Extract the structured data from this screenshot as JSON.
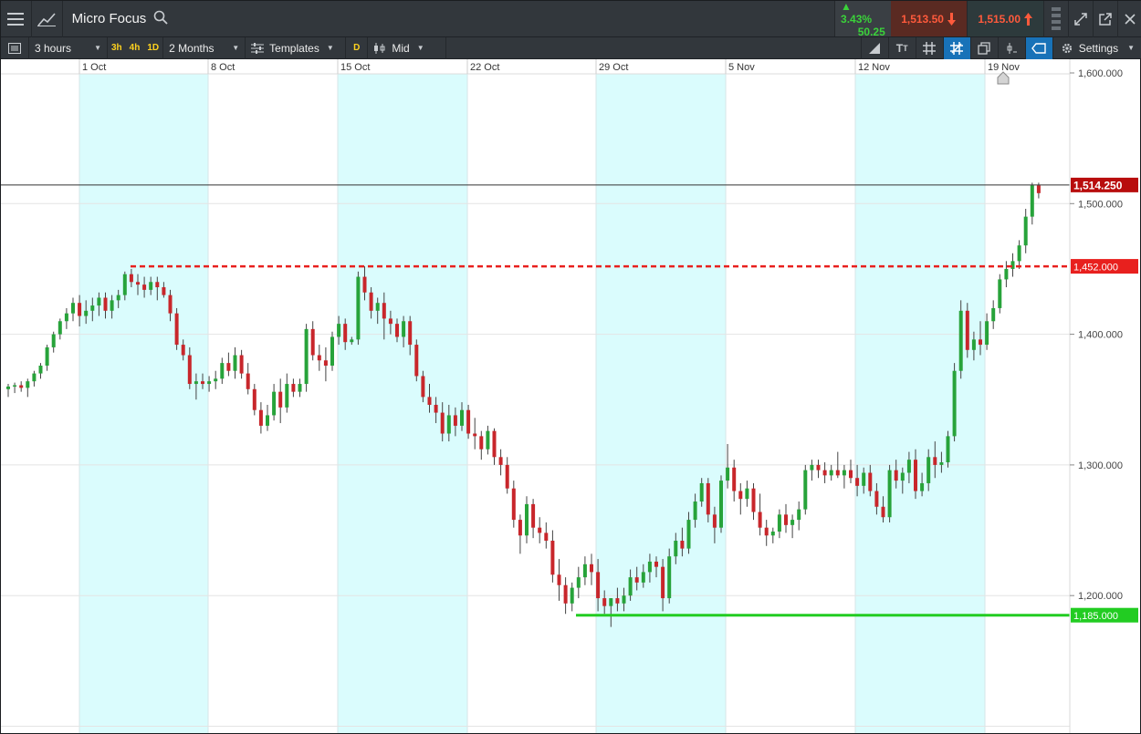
{
  "window": {
    "title": "Micro Focus",
    "change_pct": "3.43%",
    "change_abs": "50.25",
    "sell_price": "1,513.50",
    "buy_price": "1,515.00"
  },
  "toolbar": {
    "interval": "3 hours",
    "quick_intervals": [
      "3h",
      "4h",
      "1D"
    ],
    "range": "2 Months",
    "templates": "Templates",
    "d_label": "D",
    "price_type": "Mid",
    "settings": "Settings"
  },
  "colors": {
    "up": "#27a33a",
    "down": "#c8262b",
    "resistance": "#e8201e",
    "support": "#22cc22",
    "weekend_band": "#dafcfd",
    "current_price": "#b80d0d"
  },
  "icons": {
    "menu": "hamburger-icon",
    "chart": "line-chart-icon",
    "search": "search-icon",
    "settings": "gear-icon"
  },
  "chart_data": {
    "type": "candlestick",
    "x_labels": [
      "1 Oct",
      "8 Oct",
      "15 Oct",
      "22 Oct",
      "29 Oct",
      "5 Nov",
      "12 Nov",
      "19 Nov"
    ],
    "y_labels": [
      "1,600.000",
      "1,500.000",
      "1,400.000",
      "1,300.000",
      "1,200.000"
    ],
    "y_range": [
      1082,
      1610
    ],
    "current_price": {
      "value": 1514.25,
      "label": "1,514.250"
    },
    "resistance": {
      "value": 1452,
      "label": "1,452.000"
    },
    "support": {
      "value": 1185,
      "label": "1,185.000"
    },
    "candles": [
      [
        1358,
        1362,
        1352,
        1360
      ],
      [
        1360,
        1363,
        1355,
        1361
      ],
      [
        1361,
        1364,
        1356,
        1359
      ],
      [
        1359,
        1366,
        1352,
        1364
      ],
      [
        1364,
        1372,
        1360,
        1370
      ],
      [
        1370,
        1378,
        1366,
        1376
      ],
      [
        1376,
        1392,
        1372,
        1390
      ],
      [
        1390,
        1402,
        1386,
        1400
      ],
      [
        1400,
        1412,
        1396,
        1410
      ],
      [
        1410,
        1420,
        1404,
        1416
      ],
      [
        1416,
        1428,
        1410,
        1424
      ],
      [
        1424,
        1430,
        1406,
        1414
      ],
      [
        1414,
        1426,
        1408,
        1418
      ],
      [
        1418,
        1428,
        1410,
        1422
      ],
      [
        1422,
        1432,
        1414,
        1428
      ],
      [
        1428,
        1432,
        1412,
        1418
      ],
      [
        1418,
        1430,
        1412,
        1426
      ],
      [
        1426,
        1434,
        1420,
        1430
      ],
      [
        1430,
        1448,
        1426,
        1446
      ],
      [
        1446,
        1450,
        1436,
        1440
      ],
      [
        1440,
        1446,
        1430,
        1438
      ],
      [
        1438,
        1444,
        1428,
        1434
      ],
      [
        1434,
        1444,
        1430,
        1440
      ],
      [
        1440,
        1444,
        1426,
        1436
      ],
      [
        1436,
        1440,
        1428,
        1430
      ],
      [
        1430,
        1434,
        1410,
        1416
      ],
      [
        1416,
        1420,
        1388,
        1392
      ],
      [
        1392,
        1396,
        1380,
        1384
      ],
      [
        1384,
        1390,
        1358,
        1362
      ],
      [
        1362,
        1370,
        1350,
        1364
      ],
      [
        1364,
        1370,
        1358,
        1362
      ],
      [
        1362,
        1368,
        1356,
        1364
      ],
      [
        1364,
        1372,
        1358,
        1366
      ],
      [
        1366,
        1382,
        1362,
        1378
      ],
      [
        1378,
        1386,
        1368,
        1372
      ],
      [
        1372,
        1390,
        1366,
        1384
      ],
      [
        1384,
        1388,
        1366,
        1370
      ],
      [
        1370,
        1378,
        1354,
        1358
      ],
      [
        1358,
        1362,
        1338,
        1342
      ],
      [
        1342,
        1348,
        1324,
        1330
      ],
      [
        1330,
        1346,
        1326,
        1338
      ],
      [
        1338,
        1362,
        1334,
        1356
      ],
      [
        1356,
        1366,
        1332,
        1344
      ],
      [
        1344,
        1370,
        1340,
        1362
      ],
      [
        1362,
        1366,
        1352,
        1356
      ],
      [
        1356,
        1366,
        1352,
        1362
      ],
      [
        1362,
        1408,
        1356,
        1404
      ],
      [
        1404,
        1410,
        1380,
        1384
      ],
      [
        1384,
        1392,
        1372,
        1380
      ],
      [
        1380,
        1390,
        1364,
        1376
      ],
      [
        1376,
        1402,
        1372,
        1398
      ],
      [
        1398,
        1414,
        1392,
        1408
      ],
      [
        1408,
        1412,
        1388,
        1394
      ],
      [
        1394,
        1398,
        1392,
        1396
      ],
      [
        1396,
        1448,
        1392,
        1444
      ],
      [
        1444,
        1452,
        1426,
        1432
      ],
      [
        1432,
        1436,
        1412,
        1418
      ],
      [
        1418,
        1428,
        1408,
        1424
      ],
      [
        1424,
        1432,
        1396,
        1412
      ],
      [
        1412,
        1418,
        1400,
        1408
      ],
      [
        1408,
        1412,
        1394,
        1398
      ],
      [
        1398,
        1414,
        1390,
        1410
      ],
      [
        1410,
        1414,
        1384,
        1392
      ],
      [
        1392,
        1396,
        1364,
        1368
      ],
      [
        1368,
        1372,
        1348,
        1352
      ],
      [
        1352,
        1362,
        1340,
        1346
      ],
      [
        1346,
        1352,
        1332,
        1340
      ],
      [
        1340,
        1348,
        1318,
        1324
      ],
      [
        1324,
        1346,
        1318,
        1338
      ],
      [
        1338,
        1344,
        1322,
        1330
      ],
      [
        1330,
        1348,
        1326,
        1342
      ],
      [
        1342,
        1346,
        1320,
        1324
      ],
      [
        1324,
        1336,
        1312,
        1322
      ],
      [
        1322,
        1326,
        1304,
        1312
      ],
      [
        1312,
        1330,
        1308,
        1326
      ],
      [
        1326,
        1328,
        1300,
        1306
      ],
      [
        1306,
        1312,
        1292,
        1300
      ],
      [
        1300,
        1306,
        1278,
        1282
      ],
      [
        1282,
        1288,
        1252,
        1258
      ],
      [
        1258,
        1262,
        1232,
        1246
      ],
      [
        1246,
        1276,
        1240,
        1270
      ],
      [
        1270,
        1274,
        1244,
        1252
      ],
      [
        1252,
        1260,
        1240,
        1248
      ],
      [
        1248,
        1256,
        1236,
        1242
      ],
      [
        1242,
        1250,
        1210,
        1216
      ],
      [
        1216,
        1228,
        1196,
        1208
      ],
      [
        1208,
        1214,
        1186,
        1194
      ],
      [
        1194,
        1210,
        1188,
        1206
      ],
      [
        1206,
        1222,
        1198,
        1214
      ],
      [
        1214,
        1230,
        1208,
        1224
      ],
      [
        1224,
        1232,
        1208,
        1218
      ],
      [
        1218,
        1228,
        1188,
        1198
      ],
      [
        1198,
        1204,
        1186,
        1192
      ],
      [
        1192,
        1198,
        1176,
        1198
      ],
      [
        1198,
        1206,
        1188,
        1194
      ],
      [
        1194,
        1206,
        1188,
        1200
      ],
      [
        1200,
        1220,
        1196,
        1214
      ],
      [
        1214,
        1222,
        1204,
        1210
      ],
      [
        1210,
        1224,
        1206,
        1218
      ],
      [
        1218,
        1232,
        1210,
        1226
      ],
      [
        1226,
        1230,
        1214,
        1222
      ],
      [
        1222,
        1228,
        1188,
        1198
      ],
      [
        1198,
        1236,
        1194,
        1230
      ],
      [
        1230,
        1248,
        1224,
        1242
      ],
      [
        1242,
        1252,
        1230,
        1236
      ],
      [
        1236,
        1264,
        1232,
        1258
      ],
      [
        1258,
        1278,
        1252,
        1272
      ],
      [
        1272,
        1290,
        1268,
        1286
      ],
      [
        1286,
        1290,
        1256,
        1262
      ],
      [
        1262,
        1268,
        1240,
        1252
      ],
      [
        1252,
        1292,
        1248,
        1288
      ],
      [
        1288,
        1316,
        1282,
        1298
      ],
      [
        1298,
        1304,
        1272,
        1280
      ],
      [
        1280,
        1286,
        1262,
        1274
      ],
      [
        1274,
        1288,
        1268,
        1282
      ],
      [
        1282,
        1286,
        1258,
        1264
      ],
      [
        1264,
        1278,
        1246,
        1252
      ],
      [
        1252,
        1258,
        1238,
        1246
      ],
      [
        1246,
        1252,
        1240,
        1249
      ],
      [
        1249,
        1266,
        1244,
        1262
      ],
      [
        1262,
        1270,
        1248,
        1254
      ],
      [
        1254,
        1262,
        1244,
        1258
      ],
      [
        1258,
        1272,
        1250,
        1266
      ],
      [
        1266,
        1300,
        1262,
        1296
      ],
      [
        1296,
        1304,
        1288,
        1300
      ],
      [
        1300,
        1304,
        1290,
        1296
      ],
      [
        1296,
        1302,
        1286,
        1292
      ],
      [
        1292,
        1300,
        1288,
        1296
      ],
      [
        1296,
        1310,
        1290,
        1292
      ],
      [
        1292,
        1300,
        1282,
        1296
      ],
      [
        1296,
        1304,
        1286,
        1290
      ],
      [
        1290,
        1300,
        1276,
        1284
      ],
      [
        1284,
        1298,
        1278,
        1294
      ],
      [
        1294,
        1300,
        1276,
        1280
      ],
      [
        1280,
        1286,
        1262,
        1268
      ],
      [
        1268,
        1276,
        1256,
        1260
      ],
      [
        1260,
        1300,
        1256,
        1296
      ],
      [
        1296,
        1304,
        1282,
        1288
      ],
      [
        1288,
        1298,
        1278,
        1294
      ],
      [
        1294,
        1310,
        1286,
        1304
      ],
      [
        1304,
        1312,
        1274,
        1280
      ],
      [
        1280,
        1294,
        1276,
        1286
      ],
      [
        1286,
        1312,
        1280,
        1306
      ],
      [
        1306,
        1318,
        1290,
        1300
      ],
      [
        1300,
        1310,
        1294,
        1302
      ],
      [
        1302,
        1326,
        1298,
        1322
      ],
      [
        1322,
        1378,
        1318,
        1372
      ],
      [
        1372,
        1426,
        1366,
        1418
      ],
      [
        1418,
        1424,
        1382,
        1388
      ],
      [
        1388,
        1402,
        1380,
        1396
      ],
      [
        1396,
        1410,
        1384,
        1392
      ],
      [
        1392,
        1416,
        1388,
        1410
      ],
      [
        1410,
        1426,
        1404,
        1420
      ],
      [
        1420,
        1446,
        1416,
        1442
      ],
      [
        1442,
        1456,
        1436,
        1450
      ],
      [
        1450,
        1462,
        1444,
        1456
      ],
      [
        1456,
        1472,
        1450,
        1468
      ],
      [
        1468,
        1496,
        1462,
        1490
      ],
      [
        1490,
        1516,
        1484,
        1514
      ],
      [
        1514,
        1516,
        1504,
        1508
      ]
    ]
  }
}
